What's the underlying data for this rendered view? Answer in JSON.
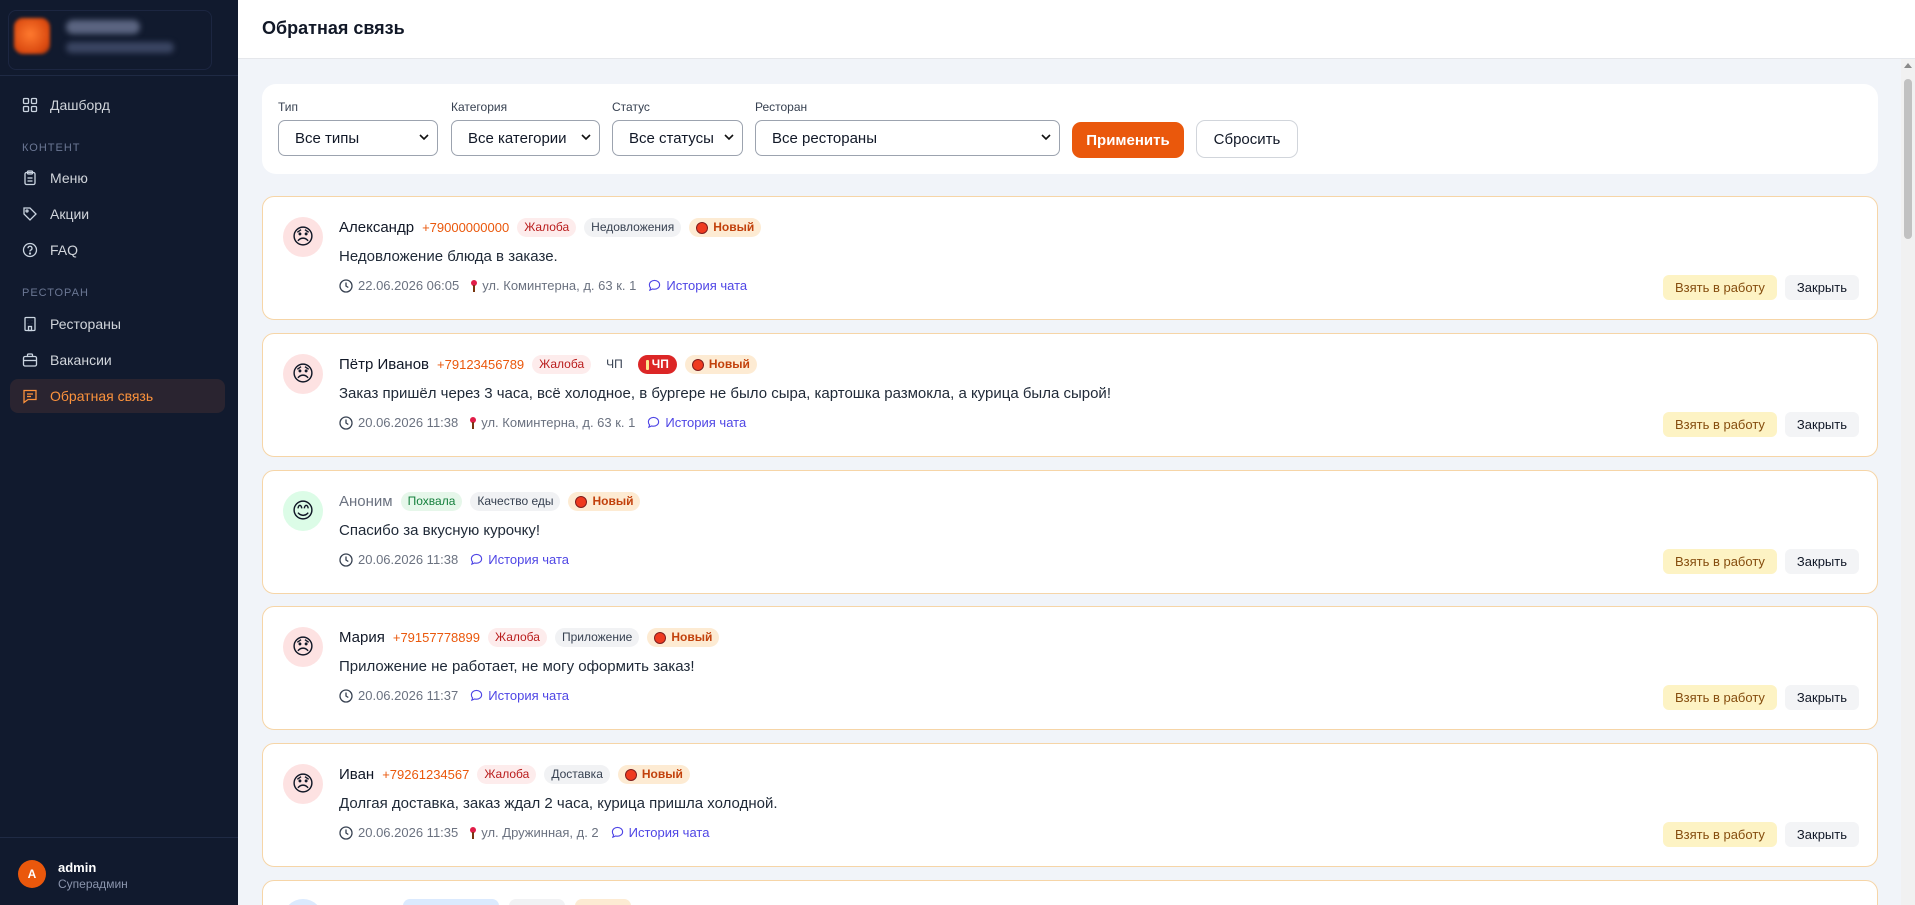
{
  "sidebar": {
    "nav": [
      {
        "label": "Дашборд",
        "icon": "grid-icon"
      },
      {
        "label": "Меню",
        "icon": "clipboard-icon"
      },
      {
        "label": "Акции",
        "icon": "tag-icon"
      },
      {
        "label": "FAQ",
        "icon": "help-circle-icon"
      },
      {
        "label": "Рестораны",
        "icon": "building-icon"
      },
      {
        "label": "Вакансии",
        "icon": "briefcase-icon"
      },
      {
        "label": "Обратная связь",
        "icon": "message-icon"
      }
    ],
    "section_content": "КОНТЕНТ",
    "section_restaurant": "РЕСТОРАН",
    "user": {
      "initial": "A",
      "name": "admin",
      "role": "Суперадмин"
    }
  },
  "header": {
    "title": "Обратная связь"
  },
  "filters": {
    "type": {
      "label": "Тип",
      "value": "Все типы"
    },
    "category": {
      "label": "Категория",
      "value": "Все категории"
    },
    "status": {
      "label": "Статус",
      "value": "Все статусы"
    },
    "restaurant": {
      "label": "Ресторан",
      "value": "Все рестораны"
    },
    "apply": "Применить",
    "reset": "Сбросить"
  },
  "card_actions": {
    "take": "Взять в работу",
    "close": "Закрыть",
    "chat": "История чата"
  },
  "feedback": [
    {
      "name": "Александр",
      "phone": "+79000000000",
      "type": "Жалоба",
      "category": "Недовложения",
      "status": "Новый",
      "message": "Недовложение блюда в заказе.",
      "date": "22.06.2026 06:05",
      "address": "ул. Коминтерна, д. 63 к. 1"
    },
    {
      "name": "Пётр Иванов",
      "phone": "+79123456789",
      "type": "Жалоба",
      "category": "ЧП",
      "emergency": "ЧП",
      "status": "Новый",
      "message": "Заказ пришёл через 3 часа, всё холодное, в бургере не было сыра, картошка размокла, а курица была сырой!",
      "date": "20.06.2026 11:38",
      "address": "ул. Коминтерна, д. 63 к. 1"
    },
    {
      "name": "Аноним",
      "type": "Похвала",
      "category": "Качество еды",
      "status": "Новый",
      "message": "Спасибо за вкусную курочку!",
      "date": "20.06.2026 11:38"
    },
    {
      "name": "Мария",
      "phone": "+79157778899",
      "type": "Жалоба",
      "category": "Приложение",
      "status": "Новый",
      "message": "Приложение не работает, не могу оформить заказ!",
      "date": "20.06.2026 11:37"
    },
    {
      "name": "Иван",
      "phone": "+79261234567",
      "type": "Жалоба",
      "category": "Доставка",
      "status": "Новый",
      "message": "Долгая доставка, заказ ждал 2 часа, курица пришла холодной.",
      "date": "20.06.2026 11:35",
      "address": "ул. Дружинная, д. 2"
    }
  ]
}
